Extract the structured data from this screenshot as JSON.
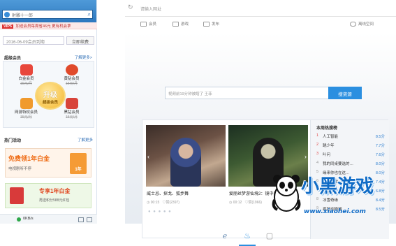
{
  "left_panel": {
    "search": {
      "value": "射雕十一郎"
    },
    "promo": {
      "tag": "VIP5",
      "text": "加送会员每周省46元 更有机会拿"
    },
    "member": {
      "date_text": "2016-06-09会员到期",
      "renew_label": "立即续费"
    },
    "vip_section": {
      "title": "超级会员",
      "more": "了解更多>",
      "upgrade_big": "升级",
      "upgrade_small": "超级会员"
    },
    "vip_items": [
      {
        "name": "白金会员",
        "price": "15元/月",
        "color": "#e8473b"
      },
      {
        "name": "黄钻会员",
        "price": "15元/月",
        "color": "#e04a2b"
      },
      {
        "name": "网游特权会员",
        "price": "15元/月",
        "color": "#f09a2d"
      },
      {
        "name": "黑钻会员",
        "price": "15元/月",
        "color": "#d8443a"
      }
    ],
    "hot_section": {
      "title": "热门活动",
      "more": "了解更多"
    },
    "banner1": {
      "title": "免费领1年白金",
      "sub": "电视剧听不停",
      "badge": "1年"
    },
    "banner2": {
      "title": "专享1年白金",
      "sub": "再送积分588元红包"
    },
    "status": {
      "speed": "0KB/s"
    }
  },
  "browser": {
    "url_placeholder": "请输入网址",
    "nav": [
      "会员",
      "游戏",
      "发布",
      "离线空间"
    ],
    "search_placeholder": "视频前19分钟被瞎了 王菲",
    "search_button": "搜资源",
    "videos": [
      {
        "title": "威士忌、探戈、狐步舞",
        "time": "00:15",
        "likes": "赞(2397)"
      },
      {
        "title": "爱丽丝梦游仙境2：镜中奇遇记",
        "time": "00:12",
        "likes": "赞(1966)"
      }
    ],
    "ranking_title": "本周热搜榜",
    "ranking": [
      {
        "n": "1",
        "title": "人工智能",
        "score": "8.5分"
      },
      {
        "n": "2",
        "title": "跳少年",
        "score": "7.7分"
      },
      {
        "n": "3",
        "title": "叶问",
        "score": "7.6分"
      },
      {
        "n": "4",
        "title": "我的同桌要选的…",
        "score": "8.0分"
      },
      {
        "n": "5",
        "title": "缘来你也在这…",
        "score": "8.0分"
      },
      {
        "n": "6",
        "title": "重返20岁",
        "score": "7.4分"
      },
      {
        "n": "7",
        "title": "暗黑",
        "score": "6.8分"
      },
      {
        "n": "8",
        "title": "冰雪奇缘",
        "score": "8.4分"
      },
      {
        "n": "9",
        "title": "疯狂动物城",
        "score": "8.5分"
      }
    ]
  },
  "watermark": {
    "text": "小黑游戏",
    "url": "www.xiaohei.com"
  },
  "colors": {
    "accent": "#2b8fe0",
    "watermark": "#0f6bc6"
  }
}
